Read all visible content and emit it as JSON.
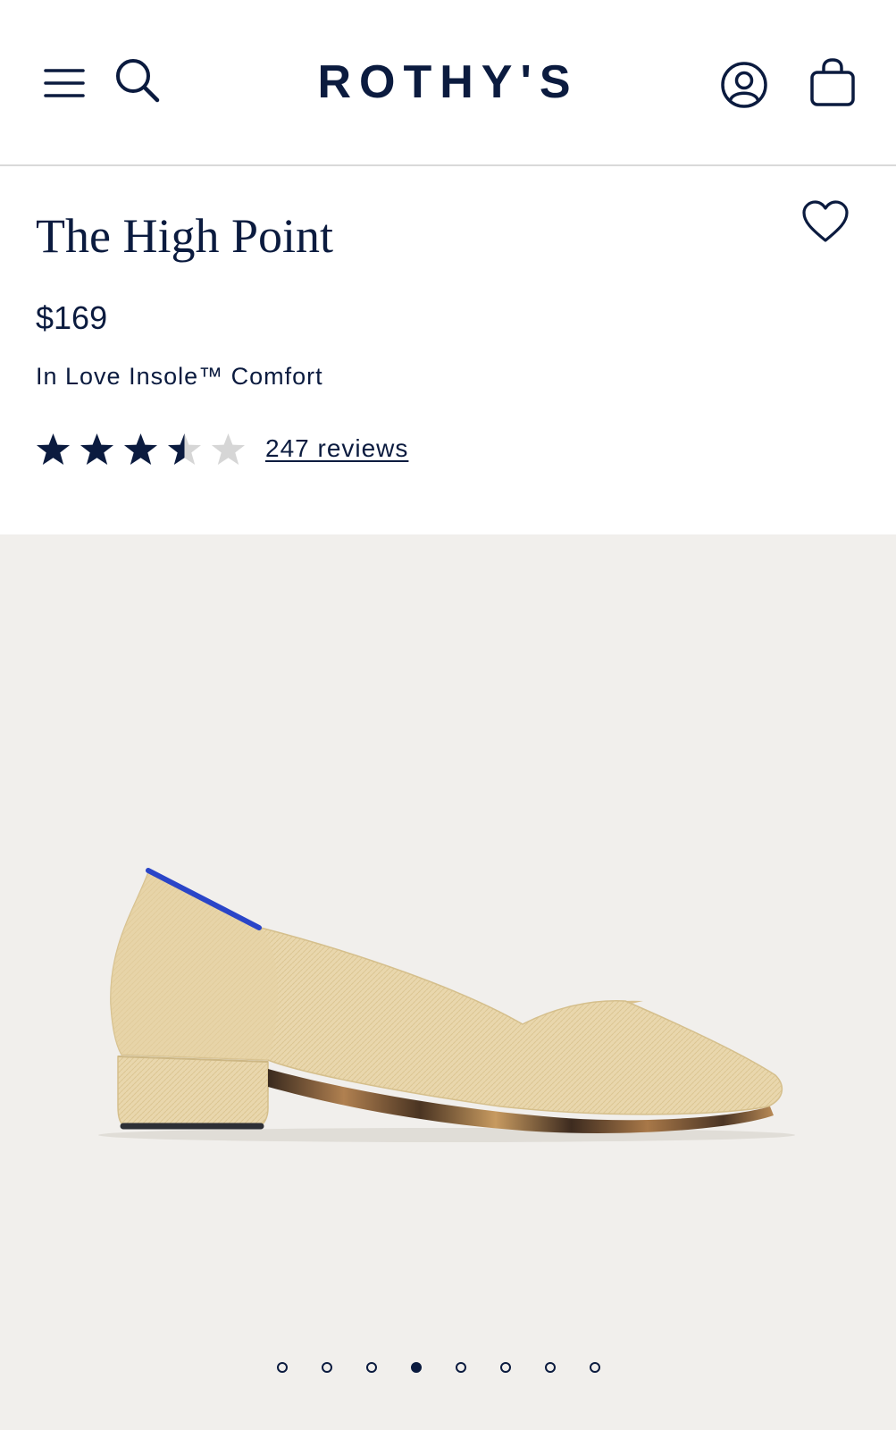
{
  "header": {
    "logo": "ROTHY'S",
    "icons": [
      "menu-icon",
      "search-icon",
      "account-icon",
      "bag-icon"
    ]
  },
  "product": {
    "title": "The High Point",
    "price": "$169",
    "feature": "In Love Insole™ Comfort",
    "rating": 3.5,
    "rating_max": 5,
    "reviews_label": "247 reviews"
  },
  "gallery": {
    "total_images": 8,
    "active_index": 3,
    "background": "#f1efec"
  },
  "colors": {
    "brand_navy": "#0b1b3f",
    "star_empty": "#d6d6d6",
    "shoe_knit": "#e8d4a8",
    "shoe_trim": "#2a45c8"
  }
}
